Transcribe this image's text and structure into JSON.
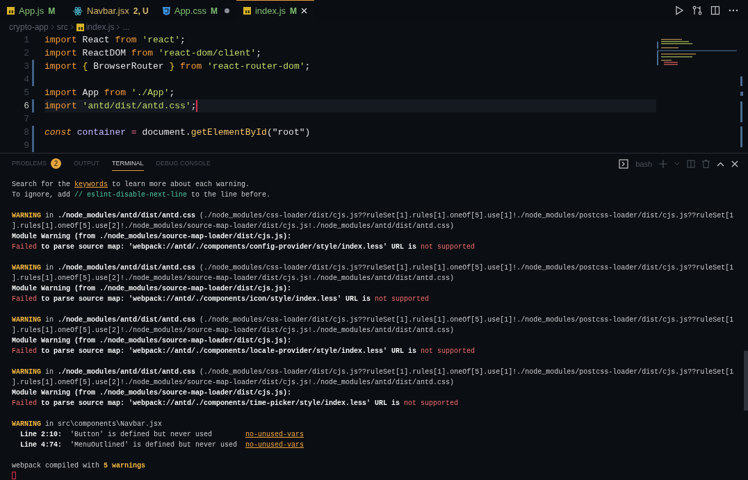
{
  "editor_tabs": [
    {
      "label": "App.js",
      "status": "M",
      "color": "#7fbf72",
      "kind": "js",
      "dirty": false,
      "selected": false
    },
    {
      "label": "Navbar.jsx",
      "status": "2, U",
      "color": "#d9b86a",
      "kind": "react",
      "dirty": false,
      "selected": false
    },
    {
      "label": "App.css",
      "status": "M",
      "color": "#7fbf72",
      "kind": "css",
      "dirty": true,
      "selected": false
    },
    {
      "label": "index.js",
      "status": "M",
      "color": "#7fbf72",
      "kind": "js",
      "dirty": false,
      "selected": true
    }
  ],
  "breadcrumb": [
    {
      "text": "crypto-app",
      "kind": "folder"
    },
    {
      "text": "src",
      "kind": "folder"
    },
    {
      "text": "index.js",
      "kind": "file"
    },
    {
      "text": "...",
      "kind": "more"
    }
  ],
  "code_lines": [
    {
      "number": "1",
      "current": false,
      "changed": false,
      "tokens": [
        {
          "kind": "kw",
          "text": "import "
        },
        {
          "kind": "id",
          "text": "React "
        },
        {
          "kind": "kw",
          "text": "from "
        },
        {
          "kind": "str",
          "text": "'react'"
        },
        {
          "kind": "id",
          "text": ";"
        }
      ]
    },
    {
      "number": "2",
      "current": false,
      "changed": false,
      "tokens": [
        {
          "kind": "kw",
          "text": "import "
        },
        {
          "kind": "id",
          "text": "ReactDOM "
        },
        {
          "kind": "kw",
          "text": "from "
        },
        {
          "kind": "str",
          "text": "'react-dom/client'"
        },
        {
          "kind": "id",
          "text": ";"
        }
      ]
    },
    {
      "number": "3",
      "current": false,
      "changed": true,
      "tokens": [
        {
          "kind": "kw",
          "text": "import "
        },
        {
          "kind": "brace",
          "text": "{ "
        },
        {
          "kind": "id",
          "text": "BrowserRouter "
        },
        {
          "kind": "brace",
          "text": "} "
        },
        {
          "kind": "kw",
          "text": "from "
        },
        {
          "kind": "str",
          "text": "'react-router-dom'"
        },
        {
          "kind": "id",
          "text": ";"
        }
      ]
    },
    {
      "number": "4",
      "current": false,
      "changed": true
    },
    {
      "number": "5",
      "current": false,
      "changed": false,
      "tokens": [
        {
          "kind": "kw",
          "text": "import "
        },
        {
          "kind": "id",
          "text": "App "
        },
        {
          "kind": "kw",
          "text": "from "
        },
        {
          "kind": "str",
          "text": "'./App'"
        },
        {
          "kind": "id",
          "text": ";"
        }
      ]
    },
    {
      "number": "6",
      "current": true,
      "changed": true,
      "tokens": [
        {
          "kind": "kw",
          "text": "import "
        },
        {
          "kind": "str",
          "text": "'antd/dist/antd.css'"
        },
        {
          "kind": "id",
          "text": ";"
        }
      ]
    },
    {
      "number": "7",
      "current": false,
      "changed": false
    },
    {
      "number": "8",
      "current": false,
      "changed": true,
      "tokens": [
        {
          "kind": "kwi",
          "text": "const "
        },
        {
          "kind": "var",
          "text": "container "
        },
        {
          "kind": "op",
          "text": "= "
        },
        {
          "kind": "id",
          "text": "document."
        },
        {
          "kind": "fn",
          "text": "getElementById"
        },
        {
          "kind": "id",
          "text": "(\"root\")"
        }
      ]
    },
    {
      "number": "9",
      "current": false,
      "changed": true
    }
  ],
  "panel_tabs": [
    {
      "label": "PROBLEMS",
      "badge": "2",
      "selected": false
    },
    {
      "label": "OUTPUT",
      "selected": false
    },
    {
      "label": "TERMINAL",
      "selected": true
    },
    {
      "label": "DEBUG CONSOLE",
      "selected": false
    }
  ],
  "terminal": {
    "shell": "bash",
    "blocks": [
      {
        "lines": [
          [
            {
              "kind": "plain",
              "text": "Search for the "
            },
            {
              "kind": "link",
              "text": "keywords"
            },
            {
              "kind": "plain",
              "text": " to learn more about each warning."
            }
          ],
          [
            {
              "kind": "plain",
              "text": "To ignore, add "
            },
            {
              "kind": "comment",
              "text": "// eslint-disable-next-line"
            },
            {
              "kind": "plain",
              "text": " to the line before."
            }
          ]
        ]
      },
      {
        "lines": [
          [
            {
              "kind": "warn",
              "text": "WARNING"
            },
            {
              "kind": "plain",
              "text": " in "
            },
            {
              "kind": "bold",
              "text": "./node_modules/antd/dist/antd.css"
            },
            {
              "kind": "plain",
              "text": " (./node_modules/css-loader/dist/cjs.js??ruleSet[1].rules[1].oneOf[5].use[1]!./node_modules/postcss-loader/dist/cjs.js??ruleSet[1"
            }
          ],
          [
            {
              "kind": "plain",
              "text": "].rules[1].oneOf[5].use[2]!./node_modules/source-map-loader/dist/cjs.js!./node_modules/antd/dist/antd.css)"
            }
          ],
          [
            {
              "kind": "bold",
              "text": "Module Warning (from ./node_modules/source-map-loader/dist/cjs.js):"
            }
          ],
          [
            {
              "kind": "error",
              "text": "Failed"
            },
            {
              "kind": "bold",
              "text": " to parse source map: 'webpack://antd/./components/config-provider/style/index.less' URL is "
            },
            {
              "kind": "error",
              "text": "not supported"
            }
          ]
        ]
      },
      {
        "lines": [
          [
            {
              "kind": "warn",
              "text": "WARNING"
            },
            {
              "kind": "plain",
              "text": " in "
            },
            {
              "kind": "bold",
              "text": "./node_modules/antd/dist/antd.css"
            },
            {
              "kind": "plain",
              "text": " (./node_modules/css-loader/dist/cjs.js??ruleSet[1].rules[1].oneOf[5].use[1]!./node_modules/postcss-loader/dist/cjs.js??ruleSet[1"
            }
          ],
          [
            {
              "kind": "plain",
              "text": "].rules[1].oneOf[5].use[2]!./node_modules/source-map-loader/dist/cjs.js!./node_modules/antd/dist/antd.css)"
            }
          ],
          [
            {
              "kind": "bold",
              "text": "Module Warning (from ./node_modules/source-map-loader/dist/cjs.js):"
            }
          ],
          [
            {
              "kind": "error",
              "text": "Failed"
            },
            {
              "kind": "bold",
              "text": " to parse source map: 'webpack://antd/./components/icon/style/index.less' URL is "
            },
            {
              "kind": "error",
              "text": "not supported"
            }
          ]
        ]
      },
      {
        "lines": [
          [
            {
              "kind": "warn",
              "text": "WARNING"
            },
            {
              "kind": "plain",
              "text": " in "
            },
            {
              "kind": "bold",
              "text": "./node_modules/antd/dist/antd.css"
            },
            {
              "kind": "plain",
              "text": " (./node_modules/css-loader/dist/cjs.js??ruleSet[1].rules[1].oneOf[5].use[1]!./node_modules/postcss-loader/dist/cjs.js??ruleSet[1"
            }
          ],
          [
            {
              "kind": "plain",
              "text": "].rules[1].oneOf[5].use[2]!./node_modules/source-map-loader/dist/cjs.js!./node_modules/antd/dist/antd.css)"
            }
          ],
          [
            {
              "kind": "bold",
              "text": "Module Warning (from ./node_modules/source-map-loader/dist/cjs.js):"
            }
          ],
          [
            {
              "kind": "error",
              "text": "Failed"
            },
            {
              "kind": "bold",
              "text": " to parse source map: 'webpack://antd/./components/locale-provider/style/index.less' URL is "
            },
            {
              "kind": "error",
              "text": "not supported"
            }
          ]
        ]
      },
      {
        "lines": [
          [
            {
              "kind": "warn",
              "text": "WARNING"
            },
            {
              "kind": "plain",
              "text": " in "
            },
            {
              "kind": "bold",
              "text": "./node_modules/antd/dist/antd.css"
            },
            {
              "kind": "plain",
              "text": " (./node_modules/css-loader/dist/cjs.js??ruleSet[1].rules[1].oneOf[5].use[1]!./node_modules/postcss-loader/dist/cjs.js??ruleSet[1"
            }
          ],
          [
            {
              "kind": "plain",
              "text": "].rules[1].oneOf[5].use[2]!./node_modules/source-map-loader/dist/cjs.js!./node_modules/antd/dist/antd.css)"
            }
          ],
          [
            {
              "kind": "bold",
              "text": "Module Warning (from ./node_modules/source-map-loader/dist/cjs.js):"
            }
          ],
          [
            {
              "kind": "error",
              "text": "Failed"
            },
            {
              "kind": "bold",
              "text": " to parse source map: 'webpack://antd/./components/time-picker/style/index.less' URL is "
            },
            {
              "kind": "error",
              "text": "not supported"
            }
          ]
        ]
      },
      {
        "lines": [
          [
            {
              "kind": "warn",
              "text": "WARNING"
            },
            {
              "kind": "plain",
              "text": " in src\\components\\Navbar.jsx"
            }
          ],
          [
            {
              "kind": "bold",
              "text": "  Line 2:10:"
            },
            {
              "kind": "plain",
              "text": "  'Button' is defined but never used        "
            },
            {
              "kind": "link",
              "text": "no-unused-vars"
            }
          ],
          [
            {
              "kind": "bold",
              "text": "  Line 4:74:"
            },
            {
              "kind": "plain",
              "text": "  'MenuOutlined' is defined but never used  "
            },
            {
              "kind": "link",
              "text": "no-unused-vars"
            }
          ]
        ]
      },
      {
        "lines": [
          [
            {
              "kind": "plain",
              "text": "webpack compiled with "
            },
            {
              "kind": "warn",
              "text": "5 warnings"
            }
          ]
        ]
      }
    ]
  }
}
